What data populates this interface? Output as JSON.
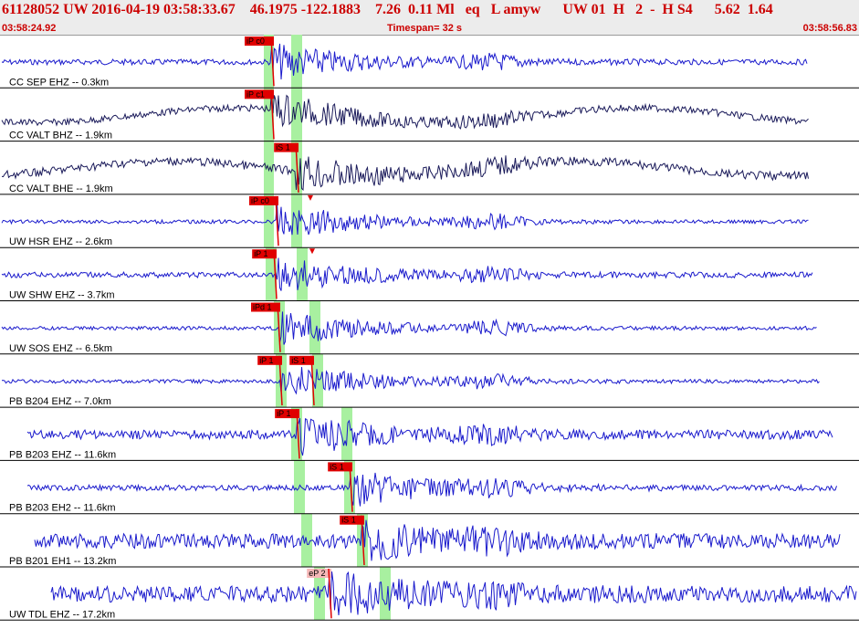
{
  "header": {
    "line": "61128052 UW 2016-04-19 03:58:33.67    46.1975 -122.1883    7.26  0.11 Ml   eq   L amyw      UW 01  H   2  -  H S4      5.62  1.64",
    "start_time": "03:58:24.92",
    "timespan": "Timespan=  32 s",
    "end_time": "03:58:56.83"
  },
  "colors": {
    "trace_blue": "#1a1acc",
    "trace_navy": "#1a1a5a",
    "pick_red": "#e00000",
    "pick_pink": "#f6b8b8",
    "window_green": "#a8f0a0",
    "header_red": "#cc0000"
  },
  "traces": [
    {
      "label": "CC SEP EHZ -- 0.3km",
      "color": "blue",
      "picks": [
        {
          "label": "iP c0",
          "style": "red"
        }
      ],
      "windows": [
        [
          289,
          300
        ],
        [
          319,
          331
        ]
      ]
    },
    {
      "label": "CC VALT BHZ -- 1.9km",
      "color": "navy",
      "picks": [
        {
          "label": "iP c1",
          "style": "red"
        }
      ],
      "windows": [
        [
          289,
          300
        ],
        [
          319,
          331
        ]
      ]
    },
    {
      "label": "CC VALT BHE -- 1.9km",
      "color": "navy",
      "picks": [
        {
          "label": "iS 1",
          "style": "red"
        }
      ],
      "windows": [
        [
          289,
          300
        ],
        [
          319,
          331
        ]
      ]
    },
    {
      "label": "UW HSR EHZ -- 2.6km",
      "color": "blue",
      "picks": [
        {
          "label": "iP c0",
          "style": "red"
        }
      ],
      "windows": [
        [
          289,
          300
        ],
        [
          319,
          331
        ]
      ]
    },
    {
      "label": "UW SHW EHZ -- 3.7km",
      "color": "blue",
      "picks": [
        {
          "label": "iP 1",
          "style": "red"
        }
      ],
      "windows": [
        [
          291,
          303
        ],
        [
          325,
          337
        ]
      ]
    },
    {
      "label": "UW SOS EHZ -- 6.5km",
      "color": "blue",
      "picks": [
        {
          "label": "iPd 1",
          "style": "red"
        }
      ],
      "windows": [
        [
          300,
          312
        ],
        [
          339,
          351
        ]
      ]
    },
    {
      "label": "PB B204 EHZ -- 7.0km",
      "color": "blue",
      "picks": [
        {
          "label": "iP 1",
          "style": "red"
        },
        {
          "label": "iS 1",
          "style": "red"
        }
      ],
      "windows": [
        [
          302,
          314
        ],
        [
          342,
          354
        ]
      ]
    },
    {
      "label": "PB B203 EHZ -- 11.6km",
      "color": "blue",
      "picks": [
        {
          "label": "iP 1",
          "style": "red"
        }
      ],
      "windows": [
        [
          319,
          331
        ],
        [
          374,
          386
        ]
      ]
    },
    {
      "label": "PB B203 EH2 -- 11.6km",
      "color": "blue",
      "picks": [
        {
          "label": "iS 1",
          "style": "red"
        }
      ],
      "windows": [
        [
          322,
          334
        ],
        [
          377,
          389
        ]
      ]
    },
    {
      "label": "PB B201 EH1 -- 13.2km",
      "color": "blue",
      "picks": [
        {
          "label": "iS 1",
          "style": "red"
        }
      ],
      "windows": [
        [
          330,
          342
        ],
        [
          391,
          403
        ]
      ]
    },
    {
      "label": "UW TDL EHZ -- 17.2km",
      "color": "blue",
      "picks": [
        {
          "label": "eP 2",
          "style": "pink"
        }
      ],
      "windows": [
        [
          344,
          356
        ],
        [
          416,
          428
        ]
      ]
    }
  ]
}
